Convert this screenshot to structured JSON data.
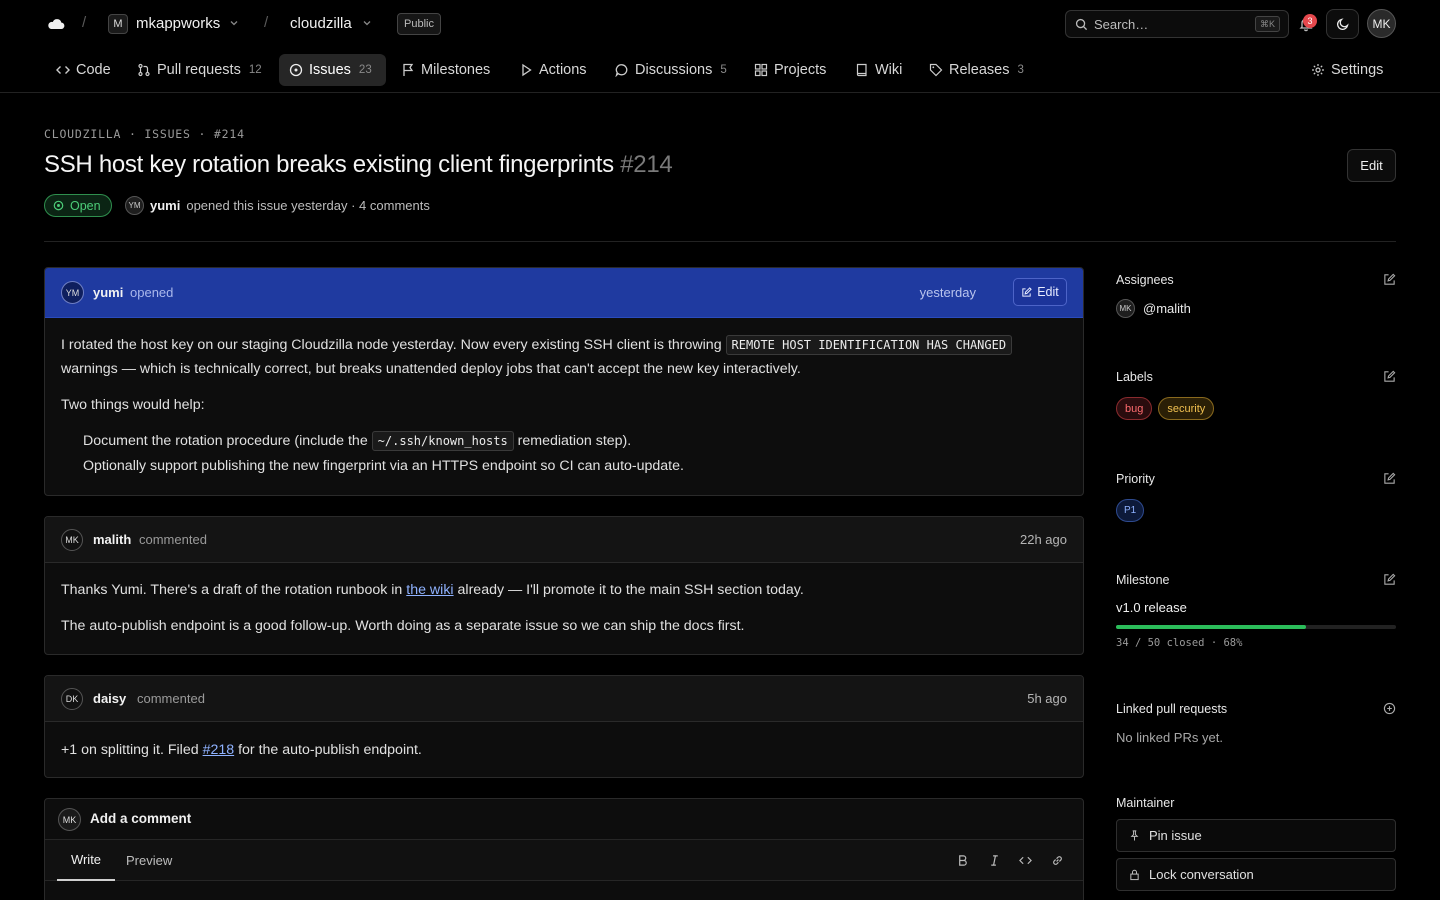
{
  "topbar": {
    "org_initial": "M",
    "org_name": "mkappworks",
    "repo_name": "cloudzilla",
    "visibility": "Public",
    "search_placeholder": "Search…",
    "search_shortcut": "⌘K",
    "notification_count": "3",
    "user_initials": "MK"
  },
  "tabs": [
    {
      "label": "Code",
      "count": ""
    },
    {
      "label": "Pull requests",
      "count": "12"
    },
    {
      "label": "Issues",
      "count": "23"
    },
    {
      "label": "Milestones",
      "count": ""
    },
    {
      "label": "Actions",
      "count": ""
    },
    {
      "label": "Discussions",
      "count": "5"
    },
    {
      "label": "Projects",
      "count": ""
    },
    {
      "label": "Wiki",
      "count": ""
    },
    {
      "label": "Releases",
      "count": "3"
    },
    {
      "label": "Settings",
      "count": ""
    }
  ],
  "issue": {
    "breadcrumb": "CLOUDZILLA · ISSUES · #214",
    "title": "SSH host key rotation breaks existing client fingerprints",
    "number": "#214",
    "edit_label": "Edit",
    "state": "Open",
    "author_initials": "YM",
    "author": "yumi",
    "opened_text": "opened this issue yesterday · 4 comments"
  },
  "comments": [
    {
      "initials": "YM",
      "author": "yumi",
      "action": "opened",
      "time": "yesterday",
      "edit_label": "Edit",
      "p1a": "I rotated the host key on our staging Cloudzilla node yesterday. Now every existing SSH client is throwing",
      "p1code": "REMOTE HOST IDENTIFICATION HAS CHANGED",
      "p1b": "warnings — which is technically correct, but breaks unattended deploy jobs that can't accept the new key interactively.",
      "p2": "Two things would help:",
      "li1a": "Document the rotation procedure (include the",
      "li1code": "~/.ssh/known_hosts",
      "li1b": "remediation step).",
      "li2": "Optionally support publishing the new fingerprint via an HTTPS endpoint so CI can auto-update."
    },
    {
      "initials": "MK",
      "author": "malith",
      "action": "commented",
      "time": "22h ago",
      "p1a": "Thanks Yumi. There's a draft of the rotation runbook in",
      "p1link": "the wiki",
      "p1b": "already — I'll promote it to the main SSH section today.",
      "p2": "The auto-publish endpoint is a good follow-up. Worth doing as a separate issue so we can ship the docs first."
    },
    {
      "initials": "DK",
      "author": "daisy",
      "action": "commented",
      "time": "5h ago",
      "p1a": "+1 on splitting it. Filed",
      "p1link": "#218",
      "p1b": "for the auto-publish endpoint."
    }
  ],
  "composer": {
    "initials": "MK",
    "title": "Add a comment",
    "tab_write": "Write",
    "tab_preview": "Preview"
  },
  "sidebar": {
    "assignees_label": "Assignees",
    "assignee_initials": "MK",
    "assignee": "@malith",
    "labels_label": "Labels",
    "label_bug": "bug",
    "label_security": "security",
    "priority_label": "Priority",
    "priority": "P1",
    "milestone_label": "Milestone",
    "milestone_name": "v1.0 release",
    "milestone_progress": 0.68,
    "milestone_stats": "34 / 50 closed · 68%",
    "linked_label": "Linked pull requests",
    "linked_empty": "No linked PRs yet.",
    "maintainer_label": "Maintainer",
    "pin_label": "Pin issue",
    "lock_label": "Lock conversation"
  },
  "colors": {
    "accent_blue": "#1f3aa0",
    "open_green": "#4ccc78",
    "progress_green": "#2bbd5a",
    "bug_red": "#e5484d",
    "security_amber": "#e6b23c"
  }
}
